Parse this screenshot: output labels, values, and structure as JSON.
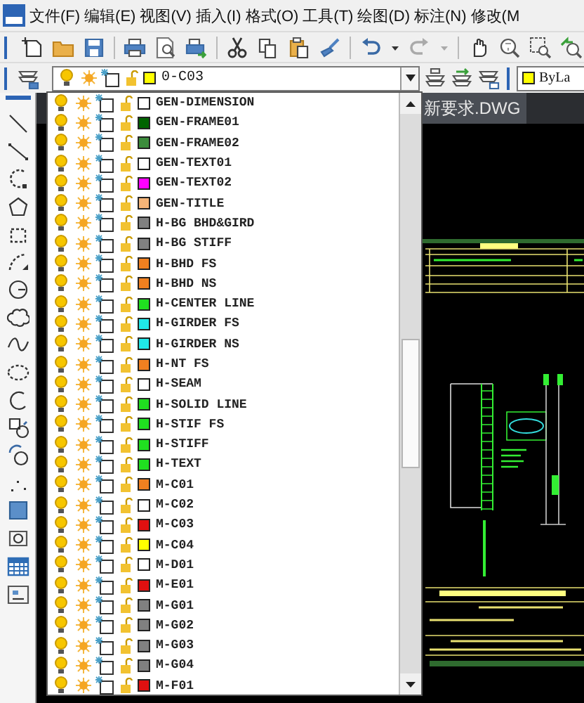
{
  "menu_bar": {
    "items": [
      "文件(F)",
      "编辑(E)",
      "视图(V)",
      "插入(I)",
      "格式(O)",
      "工具(T)",
      "绘图(D)",
      "标注(N)",
      "修改(M"
    ]
  },
  "layer_toolbar": {
    "current_layer": {
      "name": "0-C03",
      "color": "#ffff00",
      "on": true,
      "frozen": false,
      "locked": false
    },
    "color_control": {
      "label": "ByLa",
      "color": "#ffff00"
    }
  },
  "layer_dropdown": {
    "layers": [
      {
        "name": "GEN-DIMENSION",
        "color": "#ffffff",
        "on": true,
        "frozen": false,
        "locked": false
      },
      {
        "name": "GEN-FRAME01",
        "color": "#006400",
        "on": true,
        "frozen": false,
        "locked": false
      },
      {
        "name": "GEN-FRAME02",
        "color": "#3c8c3c",
        "on": true,
        "frozen": false,
        "locked": false
      },
      {
        "name": "GEN-TEXT01",
        "color": "#ffffff",
        "on": true,
        "frozen": false,
        "locked": false
      },
      {
        "name": "GEN-TEXT02",
        "color": "#ff00ff",
        "on": true,
        "frozen": false,
        "locked": false
      },
      {
        "name": "GEN-TITLE",
        "color": "#f5b478",
        "on": true,
        "frozen": false,
        "locked": false
      },
      {
        "name": "H-BG BHD&GIRD",
        "color": "#808080",
        "on": true,
        "frozen": false,
        "locked": false
      },
      {
        "name": "H-BG STIFF",
        "color": "#808080",
        "on": true,
        "frozen": false,
        "locked": false
      },
      {
        "name": "H-BHD FS",
        "color": "#f08020",
        "on": true,
        "frozen": false,
        "locked": false
      },
      {
        "name": "H-BHD NS",
        "color": "#f08020",
        "on": true,
        "frozen": false,
        "locked": false
      },
      {
        "name": "H-CENTER LINE",
        "color": "#20e020",
        "on": true,
        "frozen": false,
        "locked": false
      },
      {
        "name": "H-GIRDER FS",
        "color": "#20e8e8",
        "on": true,
        "frozen": false,
        "locked": false
      },
      {
        "name": "H-GIRDER NS",
        "color": "#20e8e8",
        "on": true,
        "frozen": false,
        "locked": false
      },
      {
        "name": "H-NT FS",
        "color": "#f08020",
        "on": true,
        "frozen": false,
        "locked": false
      },
      {
        "name": "H-SEAM",
        "color": "#ffffff",
        "on": true,
        "frozen": false,
        "locked": false
      },
      {
        "name": "H-SOLID LINE",
        "color": "#20e020",
        "on": true,
        "frozen": false,
        "locked": false
      },
      {
        "name": "H-STIF FS",
        "color": "#20e020",
        "on": true,
        "frozen": false,
        "locked": false
      },
      {
        "name": "H-STIFF",
        "color": "#20e020",
        "on": true,
        "frozen": false,
        "locked": false
      },
      {
        "name": "H-TEXT",
        "color": "#20e020",
        "on": true,
        "frozen": false,
        "locked": false
      },
      {
        "name": "M-C01",
        "color": "#f08020",
        "on": true,
        "frozen": false,
        "locked": false
      },
      {
        "name": "M-C02",
        "color": "#ffffff",
        "on": true,
        "frozen": false,
        "locked": false
      },
      {
        "name": "M-C03",
        "color": "#e01010",
        "on": true,
        "frozen": false,
        "locked": false
      },
      {
        "name": "M-C04",
        "color": "#ffff00",
        "on": true,
        "frozen": false,
        "locked": false
      },
      {
        "name": "M-D01",
        "color": "#ffffff",
        "on": true,
        "frozen": false,
        "locked": false
      },
      {
        "name": "M-E01",
        "color": "#e01010",
        "on": true,
        "frozen": false,
        "locked": false
      },
      {
        "name": "M-G01",
        "color": "#808080",
        "on": true,
        "frozen": false,
        "locked": false
      },
      {
        "name": "M-G02",
        "color": "#808080",
        "on": true,
        "frozen": false,
        "locked": false
      },
      {
        "name": "M-G03",
        "color": "#808080",
        "on": true,
        "frozen": false,
        "locked": false
      },
      {
        "name": "M-G04",
        "color": "#808080",
        "on": true,
        "frozen": false,
        "locked": false
      },
      {
        "name": "M-F01",
        "color": "#e01010",
        "on": true,
        "frozen": false,
        "locked": false
      }
    ]
  },
  "drawing_tab": {
    "title": "新要求.DWG"
  }
}
